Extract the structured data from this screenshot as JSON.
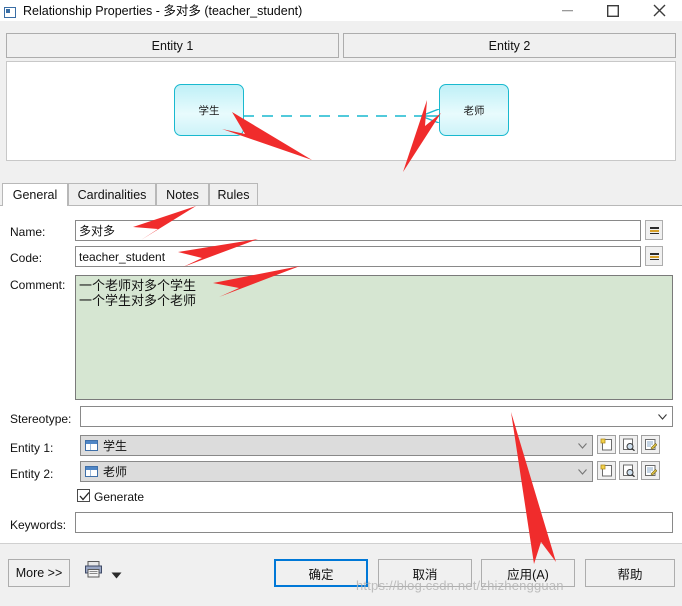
{
  "window": {
    "title": "Relationship Properties - 多对多 (teacher_student)",
    "icon": "relationship-icon",
    "controls": {
      "minimize": "minimize-icon",
      "maximize": "maximize-icon",
      "close": "close-icon"
    }
  },
  "entity_headers": [
    {
      "label": "Entity 1"
    },
    {
      "label": "Entity 2"
    }
  ],
  "diagram": {
    "entity1_label": "学生",
    "entity2_label": "老师",
    "connector": "many-to-many-dashed",
    "entity_border_color": "#19b9cf",
    "entity_fill_color": "#cdf3f9",
    "connector_color": "#19b9cf"
  },
  "tabs": [
    {
      "label": "General",
      "active": true
    },
    {
      "label": "Cardinalities",
      "active": false
    },
    {
      "label": "Notes",
      "active": false
    },
    {
      "label": "Rules",
      "active": false
    }
  ],
  "form": {
    "name": {
      "label": "Name:",
      "value": "多对多",
      "side_button": "="
    },
    "code": {
      "label": "Code:",
      "value": "teacher_student",
      "side_button": "="
    },
    "comment": {
      "label": "Comment:",
      "value": "一个老师对多个学生\n一个学生对多个老师",
      "background_color": "#d6e6d2"
    },
    "stereotype": {
      "label": "Stereotype:",
      "value": "",
      "placeholder": ""
    },
    "entity1": {
      "label": "Entity 1:",
      "value": "学生",
      "icon": "table-icon"
    },
    "entity2": {
      "label": "Entity 2:",
      "value": "老师",
      "icon": "table-icon"
    },
    "row_buttons": [
      {
        "name": "create-icon"
      },
      {
        "name": "browse-icon"
      },
      {
        "name": "properties-icon"
      }
    ],
    "generate": {
      "label": "Generate",
      "checked": true
    },
    "keywords": {
      "label": "Keywords:",
      "value": ""
    }
  },
  "bottom": {
    "more": "More >>",
    "print_icon": "print-icon",
    "print_dropdown": "chevron-down-icon",
    "ok": "确定",
    "cancel": "取消",
    "apply": "应用(A)",
    "help": "帮助",
    "accent_color": "#0078d7"
  },
  "watermark": "https://blog.csdn.net/zhizhengguan",
  "annotation_color": "#f02c2c"
}
